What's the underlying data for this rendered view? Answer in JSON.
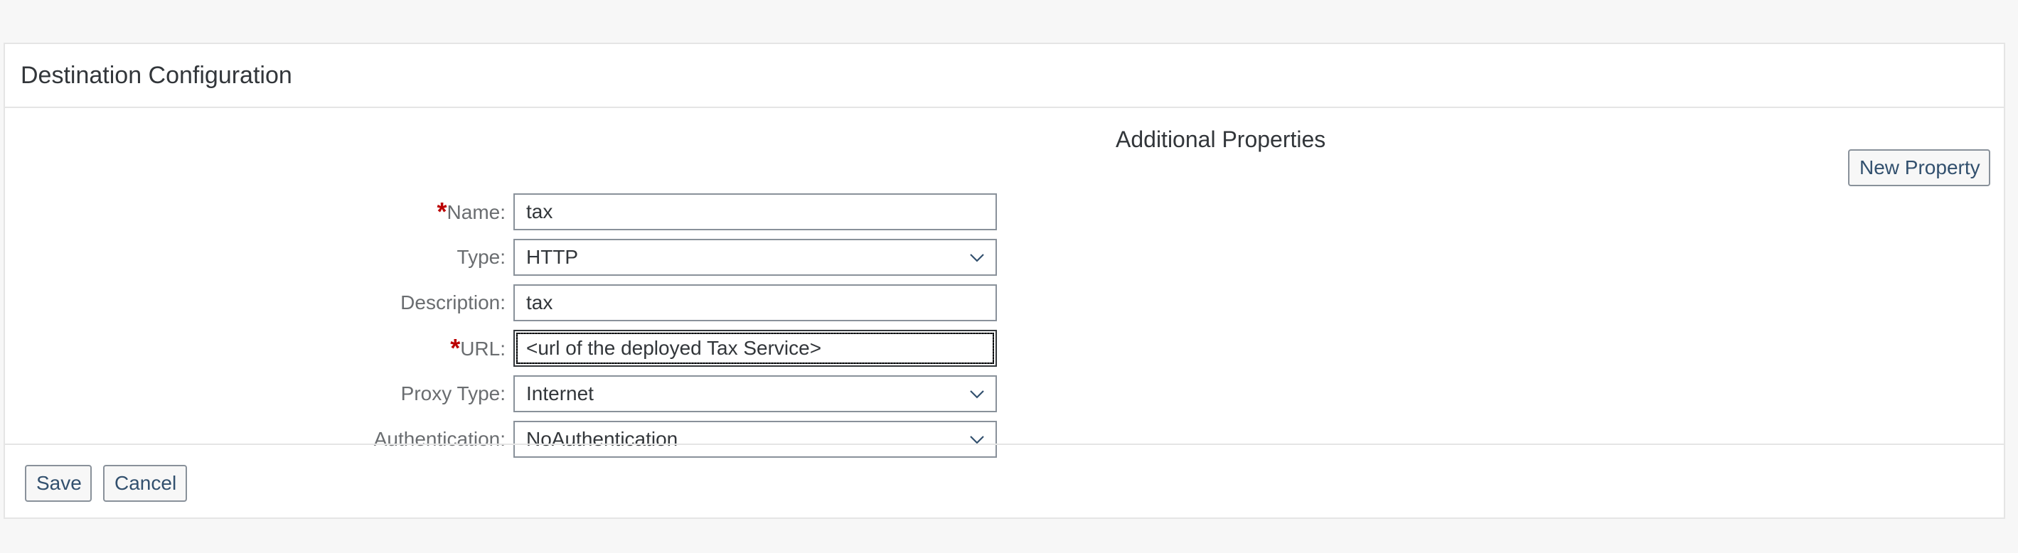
{
  "panel": {
    "title": "Destination Configuration"
  },
  "form": {
    "name": {
      "label": "Name:",
      "required_mark": "*",
      "value": "tax"
    },
    "type": {
      "label": "Type:",
      "value": "HTTP"
    },
    "description": {
      "label": "Description:",
      "value": "tax"
    },
    "url": {
      "label": "URL:",
      "required_mark": "*",
      "value": "<url of the deployed Tax Service>"
    },
    "proxy_type": {
      "label": "Proxy Type:",
      "value": "Internet"
    },
    "authentication": {
      "label": "Authentication:",
      "value": "NoAuthentication"
    }
  },
  "additional_properties": {
    "title": "Additional Properties",
    "new_property_label": "New Property"
  },
  "footer": {
    "save_label": "Save",
    "cancel_label": "Cancel"
  },
  "icons": {
    "dropdown": "chevron-down-icon"
  },
  "colors": {
    "required": "#bb0000",
    "button_text": "#32506e",
    "field_border": "#89919a"
  }
}
